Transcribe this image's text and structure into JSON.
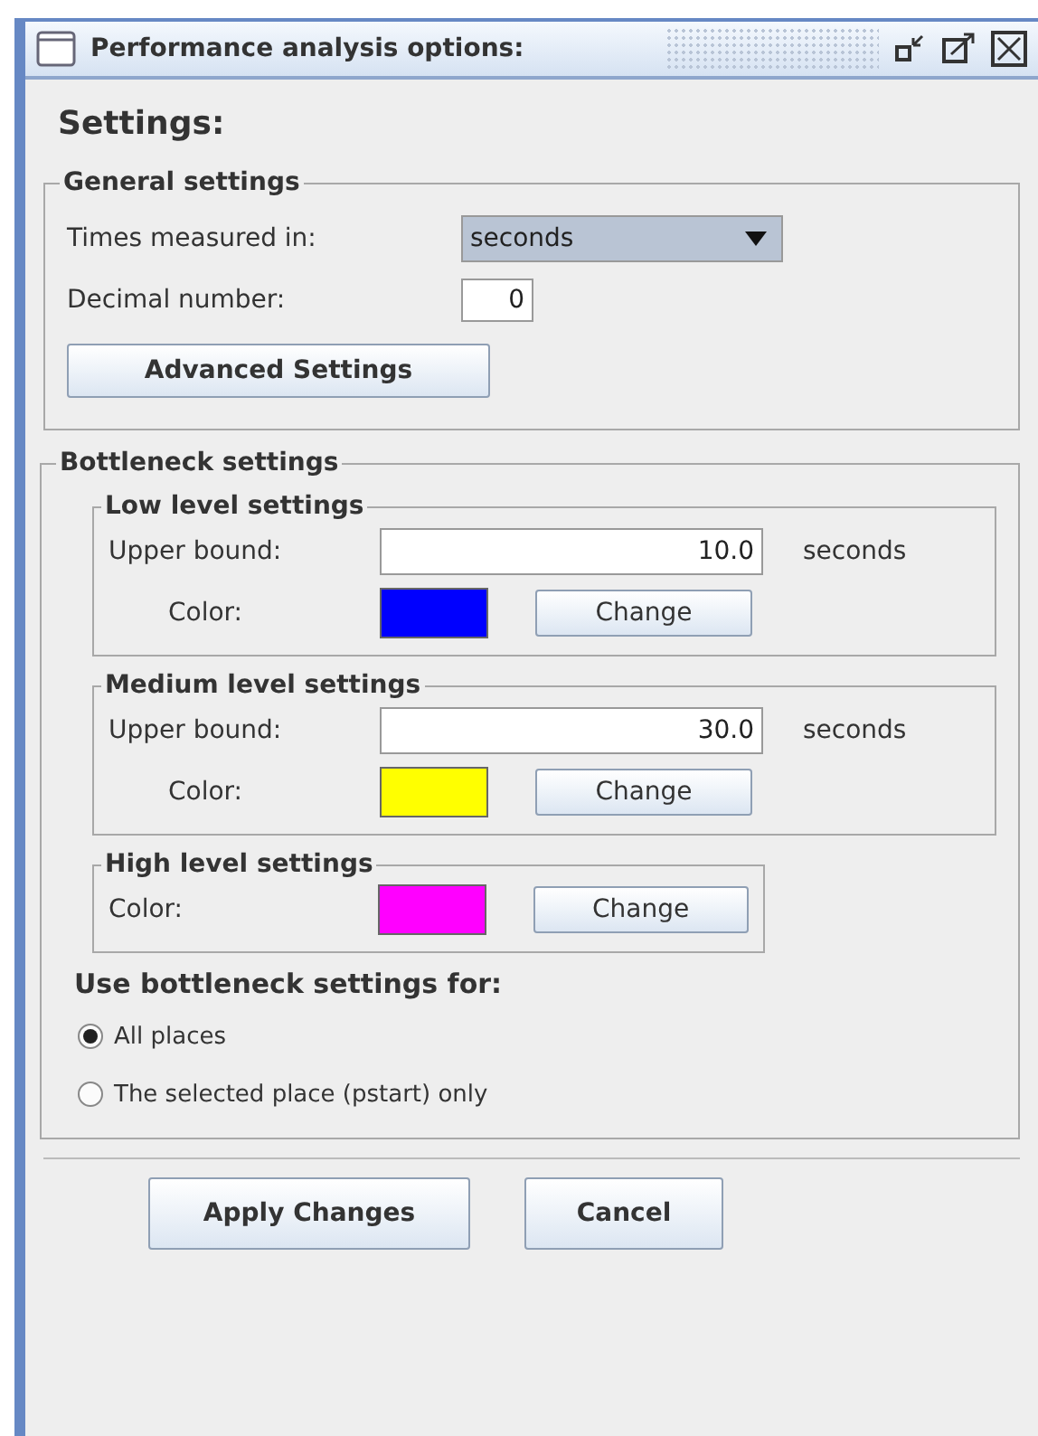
{
  "window": {
    "title": "Performance analysis options:"
  },
  "heading": "Settings:",
  "general": {
    "title": "General settings",
    "times_label": "Times measured in:",
    "times_value": "seconds",
    "decimal_label": "Decimal number:",
    "decimal_value": "0",
    "advanced_button": "Advanced Settings"
  },
  "bottleneck": {
    "title": "Bottleneck settings",
    "levels": [
      {
        "kind": "bound",
        "title": "Low level settings",
        "bound_label": "Upper bound:",
        "bound_value": "10.0",
        "unit": "seconds",
        "color_label": "Color:",
        "color": "#0000ff",
        "change_button": "Change"
      },
      {
        "kind": "bound",
        "title": "Medium level settings",
        "bound_label": "Upper bound:",
        "bound_value": "30.0",
        "unit": "seconds",
        "color_label": "Color:",
        "color": "#ffff00",
        "change_button": "Change"
      },
      {
        "kind": "color",
        "title": "High level settings",
        "color_label": "Color:",
        "color": "#ff00ff",
        "change_button": "Change"
      }
    ],
    "use_for_label": "Use bottleneck settings for:",
    "options": [
      {
        "label": "All places",
        "selected": true
      },
      {
        "label": "The selected place (pstart) only",
        "selected": false
      }
    ]
  },
  "buttons": [
    "Apply Changes",
    "Cancel"
  ]
}
